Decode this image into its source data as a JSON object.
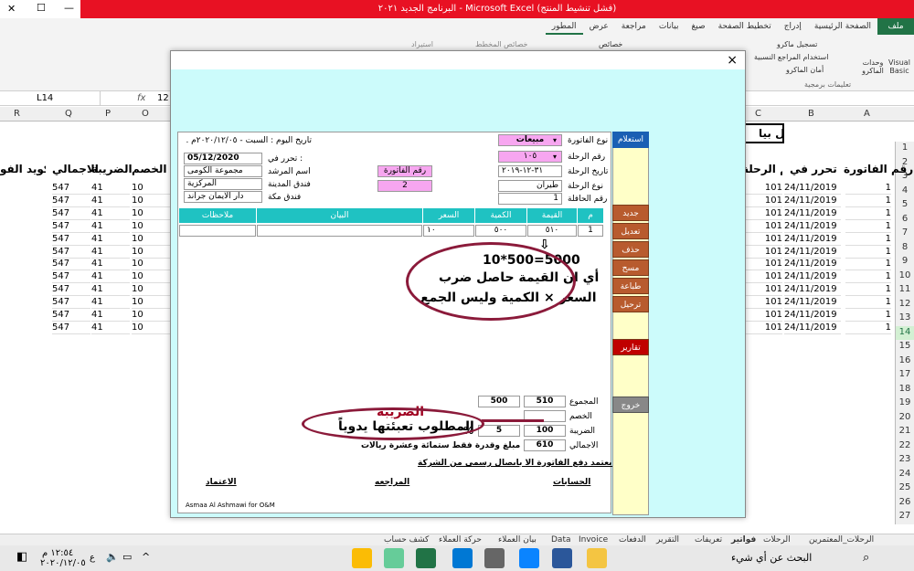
{
  "window": {
    "title": "البرنامج الجديد ٢٠٢١ - Microsoft Excel (فشل تنشيط المنتج)"
  },
  "ribbon": {
    "tabs": [
      "ملف",
      "الصفحة الرئيسية",
      "إدراج",
      "تخطيط الصفحة",
      "صيغ",
      "بيانات",
      "مراجعة",
      "عرض",
      "المطور"
    ],
    "items": {
      "vb": "Visual Basic",
      "macros": "وحدات الماكرو",
      "record": "تسجيل ماكرو",
      "relative": "استخدام المراجع النسبية",
      "security": "أمان الماكرو",
      "group_code": "تعليمات برمجية",
      "props": "خصائص",
      "map": "خصائص المخطط",
      "import": "استيراد"
    }
  },
  "formula_bar": {
    "name_box": "L14",
    "fx": "fx",
    "value": "12"
  },
  "sheet": {
    "columns": [
      "A",
      "B",
      "C",
      "O",
      "P",
      "Q",
      "R"
    ],
    "headers": [
      "رقم الفاتورة",
      "تحرر في",
      "رقم الرحلة",
      "الخصم",
      "الضريبة",
      "الاجمالي",
      "تكويد الفو"
    ],
    "rows": [
      {
        "a": "1",
        "b": "24/11/2019",
        "c": "101",
        "o": "10",
        "p": "41",
        "q": "547"
      },
      {
        "a": "1",
        "b": "24/11/2019",
        "c": "101",
        "o": "10",
        "p": "41",
        "q": "547"
      },
      {
        "a": "1",
        "b": "24/11/2019",
        "c": "101",
        "o": "10",
        "p": "41",
        "q": "547"
      },
      {
        "a": "1",
        "b": "24/11/2019",
        "c": "101",
        "o": "10",
        "p": "41",
        "q": "547"
      },
      {
        "a": "1",
        "b": "24/11/2019",
        "c": "101",
        "o": "10",
        "p": "41",
        "q": "547"
      },
      {
        "a": "1",
        "b": "24/11/2019",
        "c": "101",
        "o": "10",
        "p": "41",
        "q": "547"
      },
      {
        "a": "1",
        "b": "24/11/2019",
        "c": "101",
        "o": "10",
        "p": "41",
        "q": "547"
      },
      {
        "a": "1",
        "b": "24/11/2019",
        "c": "101",
        "o": "10",
        "p": "41",
        "q": "547"
      },
      {
        "a": "1",
        "b": "24/11/2019",
        "c": "101",
        "o": "10",
        "p": "41",
        "q": "547"
      },
      {
        "a": "1",
        "b": "24/11/2019",
        "c": "101",
        "o": "10",
        "p": "41",
        "q": "547"
      },
      {
        "a": "1",
        "b": "24/11/2019",
        "c": "101",
        "o": "10",
        "p": "41",
        "q": "547"
      },
      {
        "a": "1",
        "b": "24/11/2019",
        "c": "101",
        "o": "10",
        "p": "41",
        "q": "547"
      }
    ],
    "row_numbers": [
      "1",
      "2",
      "3",
      "4",
      "5",
      "6",
      "7",
      "8",
      "9",
      "10",
      "11",
      "12",
      "13",
      "14",
      "15",
      "16",
      "17",
      "18",
      "19",
      "20",
      "21",
      "22",
      "23",
      "24",
      "25",
      "26",
      "27"
    ],
    "enter_button": "ادخال بيا"
  },
  "dialog": {
    "close": "×",
    "today": "تاريخ اليوم : السبت - ٢٠٢٠/١٢/٠٥م .",
    "issued_lbl": "تحرر في :",
    "issued": "05/12/2020",
    "guide_lbl": "اسم المرشد",
    "guide": "مجموعة الكومى",
    "hotel_city_lbl": "فندق المدينة",
    "hotel_city": "المركزية",
    "hotel_mecca_lbl": "فندق مكة",
    "hotel_mecca": "دار الايمان جراند",
    "inv_no_lbl": "رقم الفاتورة",
    "inv_no": "2",
    "inv_type_lbl": "نوع الفاتورة",
    "inv_type": "مبيعات",
    "trip_no_lbl": "رقم الرحلة",
    "trip_no": "١٠٥",
    "trip_date_lbl": "تاريخ الرحلة",
    "trip_date": "٣١-١٢-٢٠١٩",
    "trip_kind_lbl": "نوع الرحلة",
    "trip_kind": "طيران",
    "bus_lbl": "رقم الحافلة",
    "bus": "1",
    "query_btn": "استعلام",
    "table_headers": {
      "num": "م",
      "value": "القيمة",
      "qty": "الكمية",
      "price": "السعر",
      "desc": "البيان",
      "notes": "ملاحظات"
    },
    "row": {
      "num": "1",
      "value": "٥١٠",
      "qty": "٥٠٠",
      "price": "١٠"
    },
    "side": {
      "new": "جديد",
      "edit": "تعديل",
      "delete": "حذف",
      "scan": "مسح",
      "print": "طباعة",
      "post": "ترحيل",
      "reports": "تقارير",
      "exit": "خروج"
    },
    "totals": {
      "sum_lbl": "المجموع",
      "sum_value": "510",
      "sum_qty": "500",
      "disc_lbl": "الخصم",
      "tax_lbl": "الضريبة",
      "tax_value": "100",
      "tax_rate": "5",
      "pct": "%",
      "total_lbl": "الاجمالي",
      "total_value": "610",
      "in_words": "مبلغ وقدرة فقط ستمائة وعشرة ريالات"
    },
    "note": "لا يعتمد دفع الفاتورة الا بايصال رسمى من الشركة",
    "sign": {
      "accounts": "الحسابات",
      "review": "المراجعه",
      "approve": "الاعتماد"
    },
    "footer": "Asmaa Al Ashmawi for O&M"
  },
  "annotations": {
    "formula": "10*500=5000",
    "line1": "أي ان القيمة حاصل ضرب",
    "line2": "السعر × الكمية  وليس الجمع",
    "tax_title": "الضريبة",
    "tax_note": "المطلوب تعبئتها يدوياً"
  },
  "sheet_tabs": [
    "فواتير",
    "تعريفات",
    "التقرير",
    "الدفعات",
    "Invoice",
    "Data",
    "بيان العملاء",
    "حركة العملاء",
    "كشف حساب",
    "الرحلات",
    "الرحلات_المعتمرين"
  ],
  "taskbar": {
    "search": "البحث عن أي شيء",
    "time": "١٢:٥٤ م",
    "date": "٢٠٢٠/١٢/٠٥",
    "lang": "ع"
  }
}
